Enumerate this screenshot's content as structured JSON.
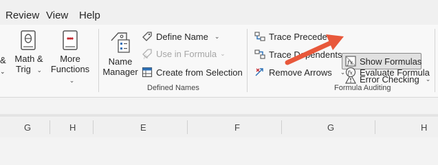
{
  "menu": {
    "tabs": [
      "Review",
      "View",
      "Help"
    ]
  },
  "ribbon": {
    "left_partial": {
      "label": "&",
      "chevron": "⌄"
    },
    "math_trig": {
      "line1": "Math &",
      "line2": "Trig",
      "chevron": "⌄"
    },
    "more_functions": {
      "line1": "More",
      "line2": "Functions",
      "chevron": "⌄"
    },
    "name_manager": {
      "line1": "Name",
      "line2": "Manager"
    },
    "define_name": {
      "label": "Define Name",
      "chevron": "⌄"
    },
    "use_in_formula": {
      "label": "Use in Formula",
      "chevron": "⌄"
    },
    "create_from_selection": {
      "label": "Create from Selection"
    },
    "defined_names_group": "Defined Names",
    "trace_precedents": {
      "label": "Trace Precede"
    },
    "trace_dependents": {
      "label": "Trace Dependents"
    },
    "remove_arrows": {
      "label": "Remove Arrows",
      "chevron": "⌄"
    },
    "show_formulas": {
      "label": "Show Formulas"
    },
    "error_checking": {
      "label": "Error Checking",
      "chevron": "⌄"
    },
    "evaluate_formula": {
      "label": "Evaluate Formula"
    },
    "formula_auditing_group": "Formula Auditing"
  },
  "columns": [
    "G",
    "H",
    "E",
    "F",
    "G",
    "H"
  ],
  "colors": {
    "arrow": "#e8583b",
    "accent_blue": "#2b6fb6",
    "red_icon": "#c4262e"
  },
  "icons": [
    "book-icon",
    "calculator-icon",
    "name-tag-icon",
    "trace-precedents-icon",
    "trace-dependents-icon",
    "remove-arrows-icon",
    "show-formulas-icon",
    "error-checking-icon",
    "evaluate-formula-icon"
  ]
}
